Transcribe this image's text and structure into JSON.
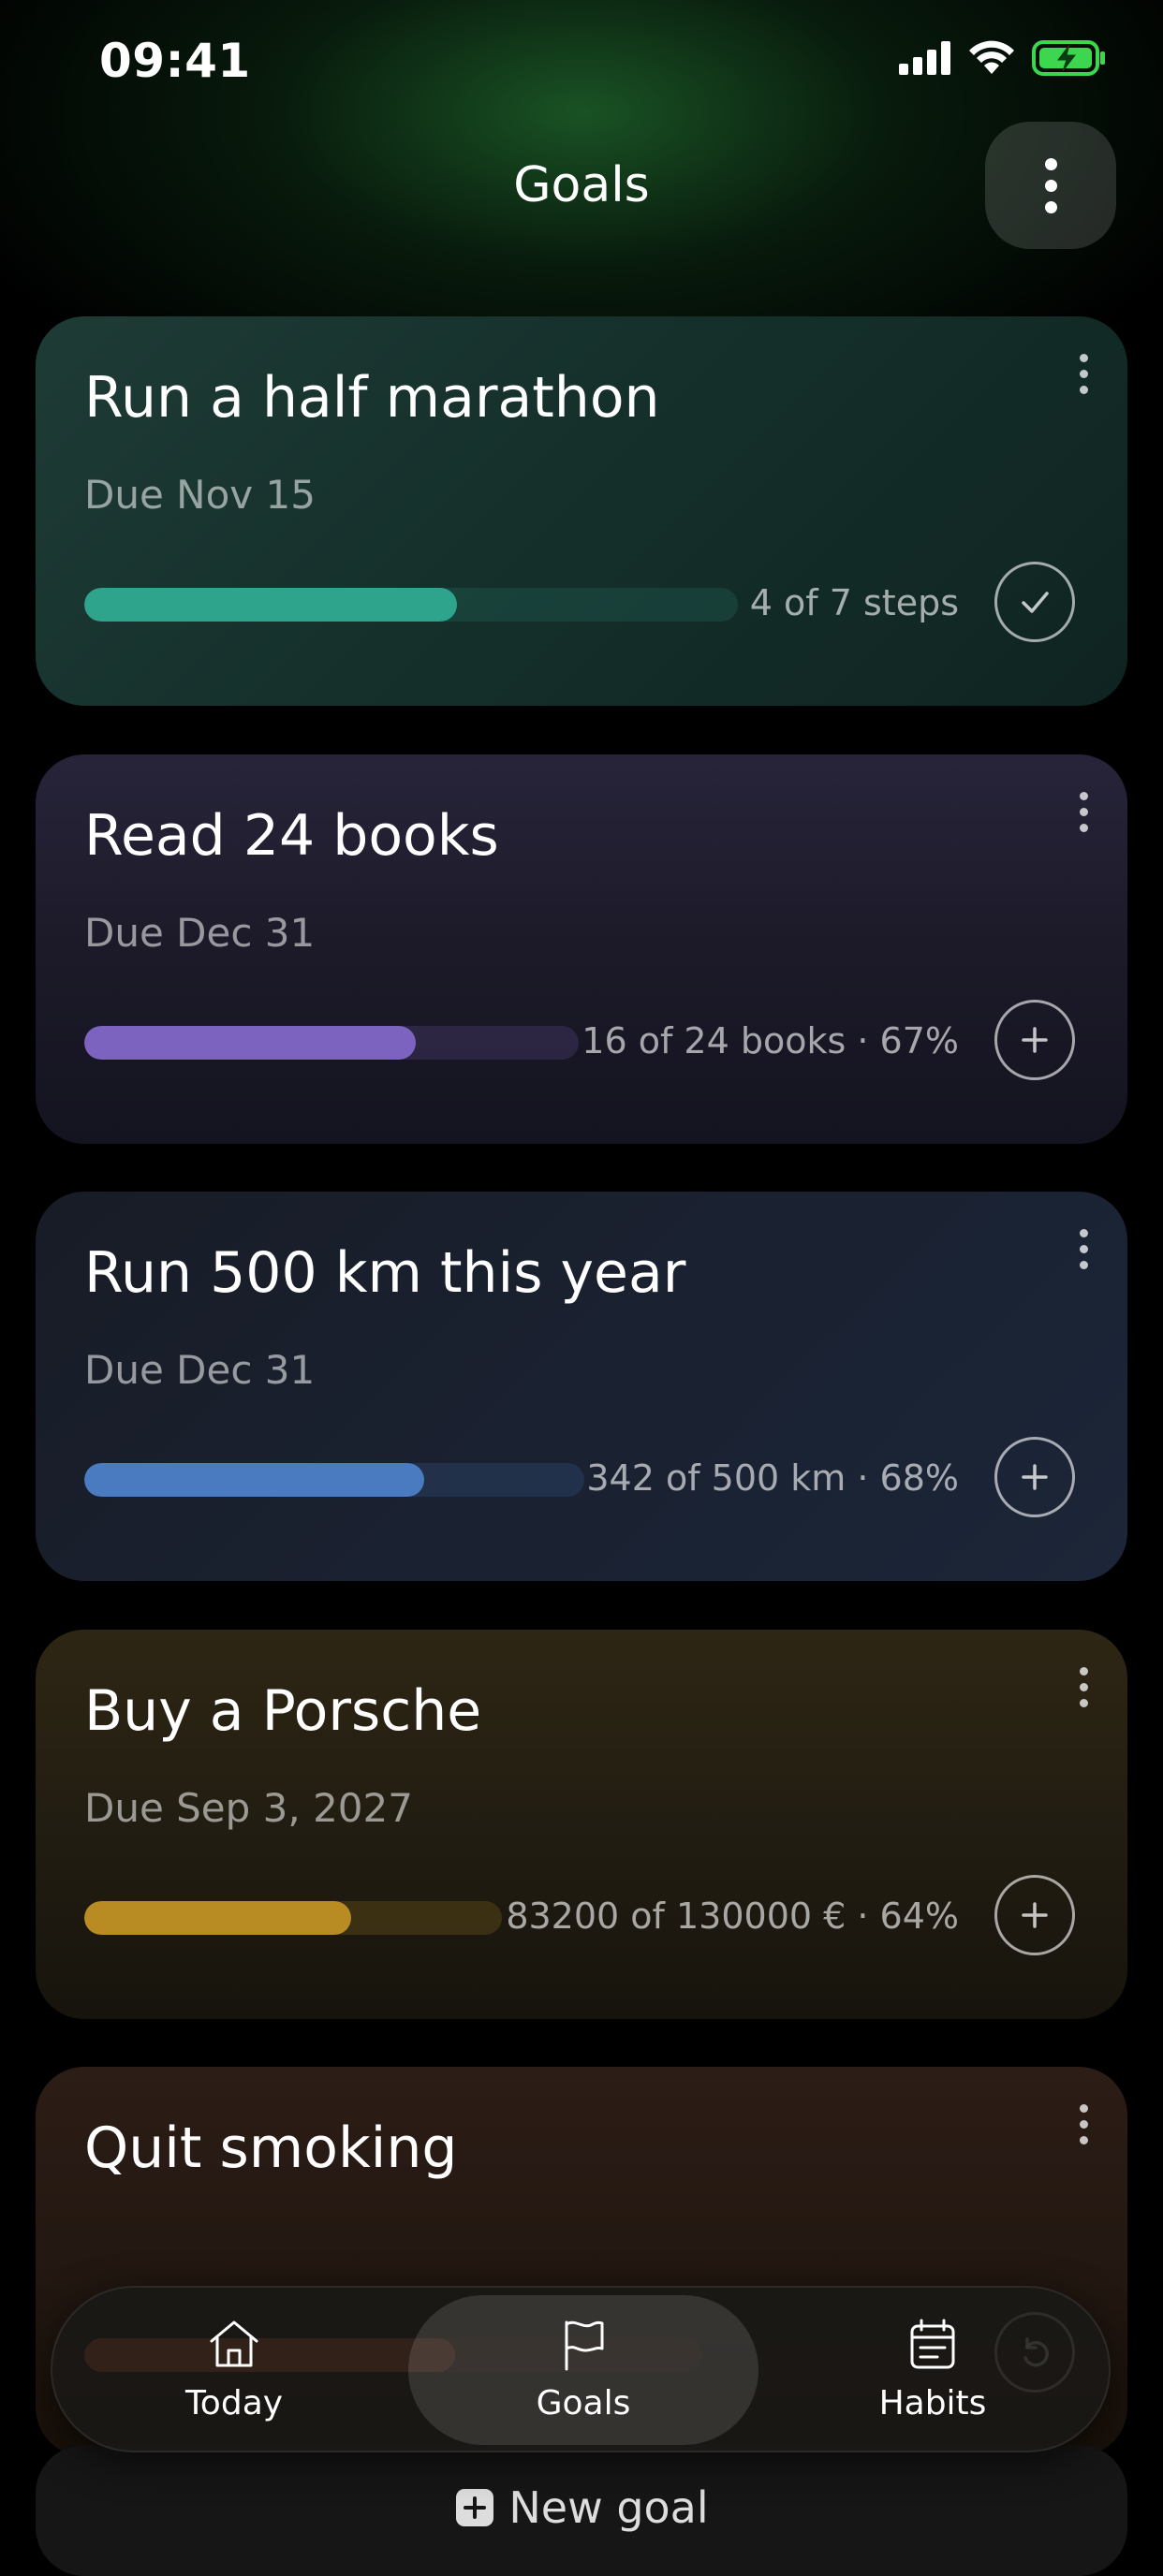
{
  "status_bar": {
    "time": "09:41"
  },
  "header": {
    "title": "Goals"
  },
  "goals": [
    {
      "title": "Run a half marathon",
      "due": "Due Nov 15",
      "progress_label": "4 of 7 steps",
      "progress": 0.57,
      "action": "check",
      "accent": "#2fa48c"
    },
    {
      "title": "Read 24 books",
      "due": "Due Dec 31",
      "progress_label": "16 of 24 books · 67%",
      "progress": 0.67,
      "action": "plus",
      "accent": "#7c63c0"
    },
    {
      "title": "Run 500 km this year",
      "due": "Due Dec 31",
      "progress_label": "342 of 500 km · 68%",
      "progress": 0.68,
      "action": "plus",
      "accent": "#4a7bc0"
    },
    {
      "title": "Buy a Porsche",
      "due": "Due Sep 3, 2027",
      "progress_label": "83200 of 130000 € · 64%",
      "progress": 0.64,
      "action": "plus",
      "accent": "#b88c22"
    },
    {
      "title": "Quit smoking",
      "due": "",
      "progress_label": "",
      "progress": 0.6,
      "action": "undo",
      "accent": "#c2552a"
    }
  ],
  "tabbar": {
    "today": "Today",
    "goals": "Goals",
    "habits": "Habits"
  },
  "new_goal_label": "New goal"
}
